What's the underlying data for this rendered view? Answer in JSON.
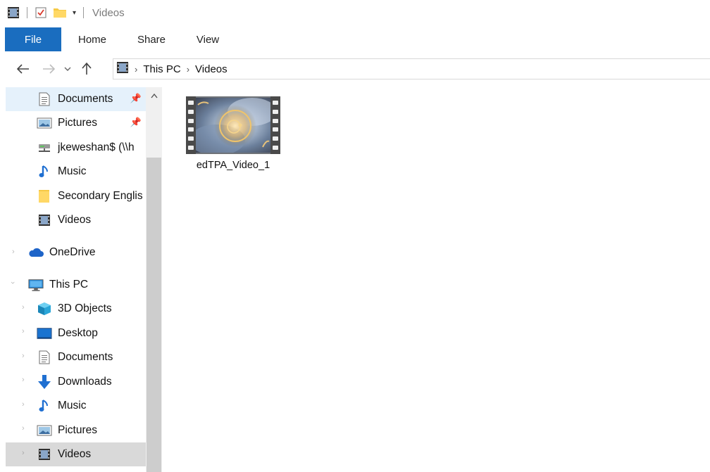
{
  "window": {
    "title": "Videos"
  },
  "ribbon": {
    "tabs": [
      "File",
      "Home",
      "Share",
      "View"
    ],
    "active_color": "#1a6dbf"
  },
  "address": {
    "crumbs": [
      "This PC",
      "Videos"
    ]
  },
  "navpane": {
    "quick_access": [
      {
        "label": "Documents",
        "icon": "documents-icon",
        "pinned": true,
        "selected": true
      },
      {
        "label": "Pictures",
        "icon": "pictures-icon",
        "pinned": true
      },
      {
        "label": "jkeweshan$ (\\\\h",
        "icon": "network-drive-icon"
      },
      {
        "label": "Music",
        "icon": "music-icon"
      },
      {
        "label": "Secondary Englis",
        "icon": "folder-icon"
      },
      {
        "label": "Videos",
        "icon": "videos-icon"
      }
    ],
    "onedrive": {
      "label": "OneDrive",
      "icon": "onedrive-icon"
    },
    "this_pc": {
      "label": "This PC",
      "icon": "this-pc-icon",
      "children": [
        {
          "label": "3D Objects",
          "icon": "3d-objects-icon"
        },
        {
          "label": "Desktop",
          "icon": "desktop-icon"
        },
        {
          "label": "Documents",
          "icon": "documents-icon"
        },
        {
          "label": "Downloads",
          "icon": "downloads-icon"
        },
        {
          "label": "Music",
          "icon": "music-icon"
        },
        {
          "label": "Pictures",
          "icon": "pictures-icon"
        },
        {
          "label": "Videos",
          "icon": "videos-icon",
          "selected": true
        }
      ]
    }
  },
  "content": {
    "files": [
      {
        "name": "edTPA_Video_1",
        "type": "video"
      }
    ]
  },
  "colors": {
    "selected_top": "#e5f1fb",
    "selected_bottom": "#d9d9d9",
    "file_tab": "#1a6dbf"
  }
}
